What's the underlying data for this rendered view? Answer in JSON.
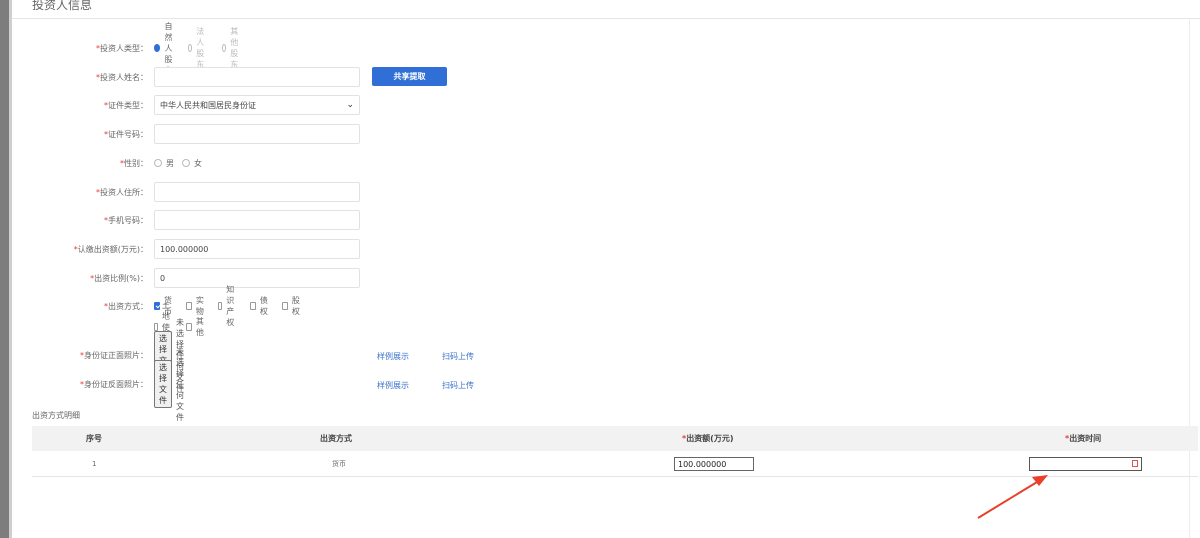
{
  "section": {
    "title": "投资人信息"
  },
  "form": {
    "investor_type": {
      "label": "投资人类型：",
      "options": [
        "自然人股东",
        "法人股东",
        "其他股东"
      ],
      "selected": "自然人股东"
    },
    "investor_name": {
      "label": "投资人姓名：",
      "value": ""
    },
    "share_extract_button": "共享提取",
    "id_type": {
      "label": "证件类型：",
      "value": "中华人民共和国居民身份证"
    },
    "id_number": {
      "label": "证件号码：",
      "value": ""
    },
    "gender": {
      "label": "性别：",
      "options": [
        "男",
        "女"
      ]
    },
    "address": {
      "label": "投资人住所：",
      "value": ""
    },
    "phone": {
      "label": "手机号码：",
      "value": ""
    },
    "subscribed_amount": {
      "label": "认缴出资额(万元)：",
      "value": "100.000000"
    },
    "contribution_ratio": {
      "label": "出资比例(%)：",
      "value": "0"
    },
    "contribution_method": {
      "label": "出资方式：",
      "options": [
        "货币",
        "实物",
        "知识产权",
        "债权",
        "股权",
        "土地使用权",
        "其他"
      ],
      "checked": [
        "货币"
      ]
    },
    "id_front": {
      "label": "身份证正面照片：",
      "file_button": "选择文件",
      "file_status": "未选择任何文件",
      "example_link": "样例展示",
      "scan_link": "扫码上传"
    },
    "id_back": {
      "label": "身份证反面照片：",
      "file_button": "选择文件",
      "file_status": "未选择任何文件",
      "example_link": "样例展示",
      "scan_link": "扫码上传"
    }
  },
  "detail": {
    "title": "出资方式明细",
    "headers": {
      "index": "序号",
      "method": "出资方式",
      "amount": "出资额(万元)",
      "date": "出资时间"
    },
    "rows": [
      {
        "index": "1",
        "method": "货币",
        "amount": "100.000000",
        "date": ""
      }
    ]
  },
  "colors": {
    "accent": "#2f6fd6",
    "required": "#e23c3c",
    "annotation_arrow": "#e8402a"
  },
  "icons": {
    "calendar": "calendar-icon",
    "dropdown": "chevron-down-icon"
  }
}
